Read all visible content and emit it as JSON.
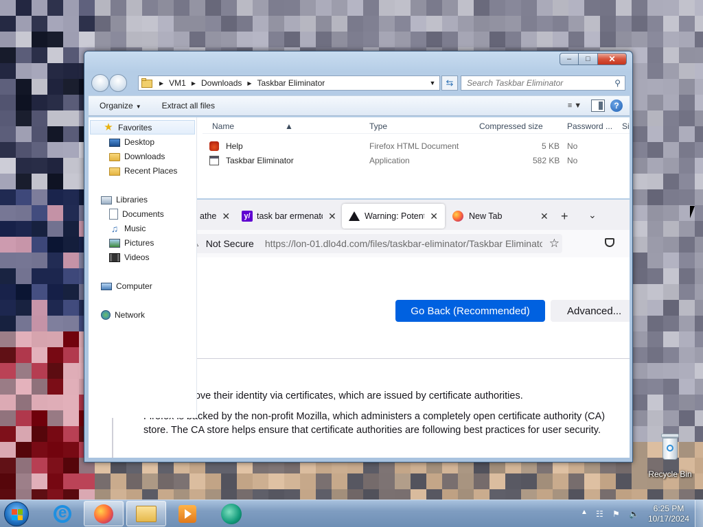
{
  "desktop": {
    "recycle_bin_label": "Recycle Bin",
    "icons": {
      "recycle_bin": "recycle-bin-icon"
    }
  },
  "explorer": {
    "caption": {
      "minimize": "–",
      "maximize": "□",
      "close": "✕"
    },
    "breadcrumb": [
      "VM1",
      "Downloads",
      "Taskbar Eliminator"
    ],
    "search_placeholder": "Search Taskbar Eliminator",
    "toolbar": {
      "organize": "Organize",
      "extract_all": "Extract all files"
    },
    "sidebar": {
      "favorites": "Favorites",
      "favorites_items": [
        "Desktop",
        "Downloads",
        "Recent Places"
      ],
      "libraries": "Libraries",
      "libraries_items": [
        "Documents",
        "Music",
        "Pictures",
        "Videos"
      ],
      "computer": "Computer",
      "network": "Network"
    },
    "columns": [
      "Name",
      "Type",
      "Compressed size",
      "Password ...",
      "Si"
    ],
    "files": [
      {
        "name": "Help",
        "type": "Firefox HTML Document",
        "size": "5 KB",
        "password": "No",
        "icon": "firefox-html-icon"
      },
      {
        "name": "Taskbar Eliminator",
        "type": "Application",
        "size": "582 KB",
        "password": "No",
        "icon": "application-icon"
      }
    ]
  },
  "firefox": {
    "tabs": [
      {
        "label": "athe",
        "icon": ""
      },
      {
        "label": "task bar ermenato",
        "icon": "yahoo-icon"
      },
      {
        "label": "Warning: Potentia",
        "icon": "warning-icon"
      },
      {
        "label": "New Tab",
        "icon": "firefox-icon"
      }
    ],
    "url_security": "Not Secure",
    "url": "https://lon-01.dlo4d.com/files/taskbar-eliminator/Taskbar Eliminator",
    "go_back": "Go Back (Recommended)",
    "advanced": "Advanced...",
    "paragraph1": "rove their identity via certificates, which are issued by certificate authorities.",
    "paragraph2": "Firefox is backed by the non-profit Mozilla, which administers a completely open certificate authority (CA) store. The CA store helps ensure that certificate authorities are following best practices for user security."
  },
  "taskbar": {
    "time": "6:25 PM",
    "date": "10/17/2024",
    "pinned": [
      "internet-explorer-icon",
      "firefox-icon",
      "file-explorer-icon",
      "media-player-icon",
      "app-icon"
    ]
  },
  "colors": {
    "firefox_primary": "#0061e0",
    "explorer_frame": "#b5cde6",
    "taskbar": "#7f9dc1"
  }
}
